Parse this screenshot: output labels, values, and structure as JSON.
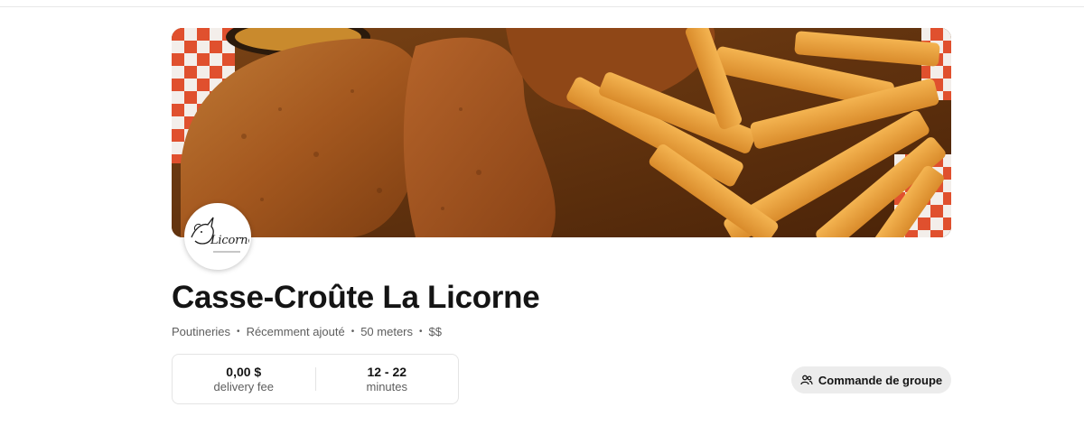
{
  "restaurant": {
    "name": "Casse-Croûte La Licorne",
    "logo_text": "Licorne",
    "hero_alt": "Fried chicken and fries"
  },
  "meta": {
    "category": "Poutineries",
    "status": "Récemment ajouté",
    "distance": "50 meters",
    "price": "$$"
  },
  "delivery": {
    "fee_value": "0,00 $",
    "fee_label": "delivery fee",
    "time_value": "12 - 22",
    "time_label": "minutes"
  },
  "actions": {
    "group_order_label": "Commande de groupe",
    "group_order_icon": "group-people-icon"
  },
  "colors": {
    "button_bg": "#ececec",
    "text_primary": "#141414",
    "text_secondary": "#5e5e5e"
  }
}
